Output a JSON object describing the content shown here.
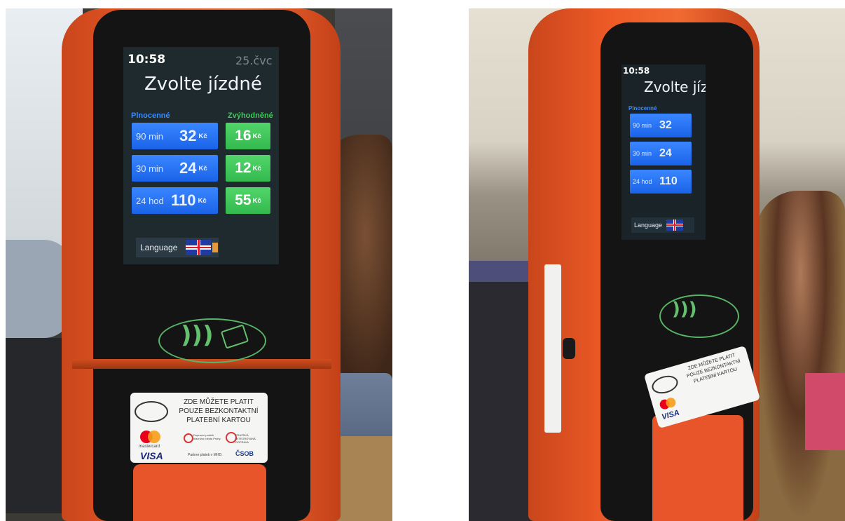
{
  "left_photo": {
    "screen": {
      "time": "10:58",
      "date": "25.čvc",
      "title": "Zvolte jízdné",
      "col_full": "Plnocenné",
      "col_discount": "Zvýhodněné",
      "fares": [
        {
          "duration": "90 min",
          "full_price": "32",
          "discount_price": "16",
          "currency": "Kč"
        },
        {
          "duration": "30 min",
          "full_price": "24",
          "discount_price": "12",
          "currency": "Kč"
        },
        {
          "duration": "24 hod",
          "full_price": "110",
          "discount_price": "55",
          "currency": "Kč"
        }
      ],
      "language_label": "Language"
    },
    "sticker": {
      "line1": "ZDE MŮŽETE PLATIT",
      "line2": "POUZE BEZKONTAKTNÍ",
      "line3": "PLATEBNÍ KARTOU",
      "mastercard": "mastercard",
      "visa": "VISA",
      "partner1": "Dopravní podnik hlavního města Prahy",
      "partner2": "PRAŽSKÁ INTEGROVANÁ DOPRAVA",
      "partner_label": "Partner plateb v MHD:",
      "bank": "ČSOB"
    }
  },
  "right_photo": {
    "screen": {
      "time": "10:58",
      "title": "Zvolte jízdné",
      "col_full": "Plnocenné",
      "fares": [
        {
          "duration": "90 min",
          "full_price": "32"
        },
        {
          "duration": "30 min",
          "full_price": "24"
        },
        {
          "duration": "24 hod",
          "full_price": "110"
        }
      ],
      "language_label": "Language"
    },
    "sticker": {
      "line1": "ZDE MŮŽETE PLATIT",
      "line2": "POUZE BEZKONTAKTNÍ",
      "line3": "PLATEBNÍ KARTOU",
      "visa": "VISA"
    }
  },
  "colors": {
    "machine_orange": "#ee5a26",
    "fare_blue": "#2a74f5",
    "fare_green": "#44c85c",
    "header_blue": "#3a8bff",
    "header_green": "#44c85c"
  }
}
